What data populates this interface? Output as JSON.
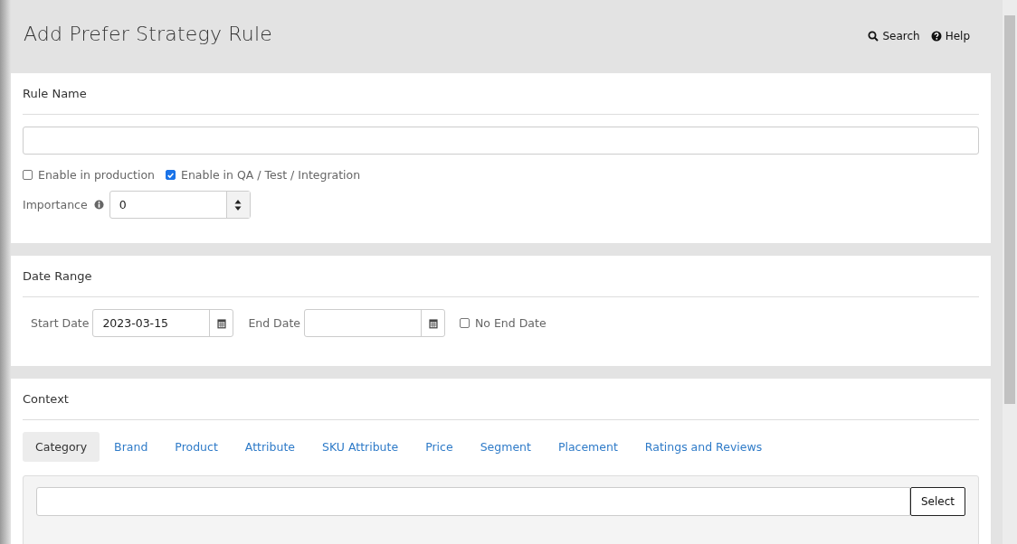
{
  "page": {
    "title": "Add Prefer Strategy Rule",
    "links": [
      {
        "kind": "search",
        "label": "Search"
      },
      {
        "kind": "help",
        "label": "Help"
      }
    ]
  },
  "rule_name": {
    "heading": "Rule Name",
    "options": [
      {
        "label": "Enable in production",
        "checked": false
      },
      {
        "label": "Enable in QA / Test / Integration",
        "checked": true
      }
    ],
    "importance": {
      "label": "Importance",
      "value": "0"
    }
  },
  "date_range": {
    "heading": "Date Range",
    "start_label": "Start Date",
    "start_value": "2023-03-15",
    "end_label": "End Date",
    "no_end": {
      "label": "No End Date",
      "checked": false
    }
  },
  "context": {
    "heading": "Context",
    "tabs": [
      {
        "label": "Category",
        "selected": true
      },
      {
        "label": "Brand",
        "selected": false
      },
      {
        "label": "Product",
        "selected": false
      },
      {
        "label": "Attribute",
        "selected": false
      },
      {
        "label": "SKU Attribute",
        "selected": false
      },
      {
        "label": "Price",
        "selected": false
      },
      {
        "label": "Segment",
        "selected": false
      },
      {
        "label": "Placement",
        "selected": false
      },
      {
        "label": "Ratings and Reviews",
        "selected": false
      }
    ],
    "select_button": "Select"
  }
}
